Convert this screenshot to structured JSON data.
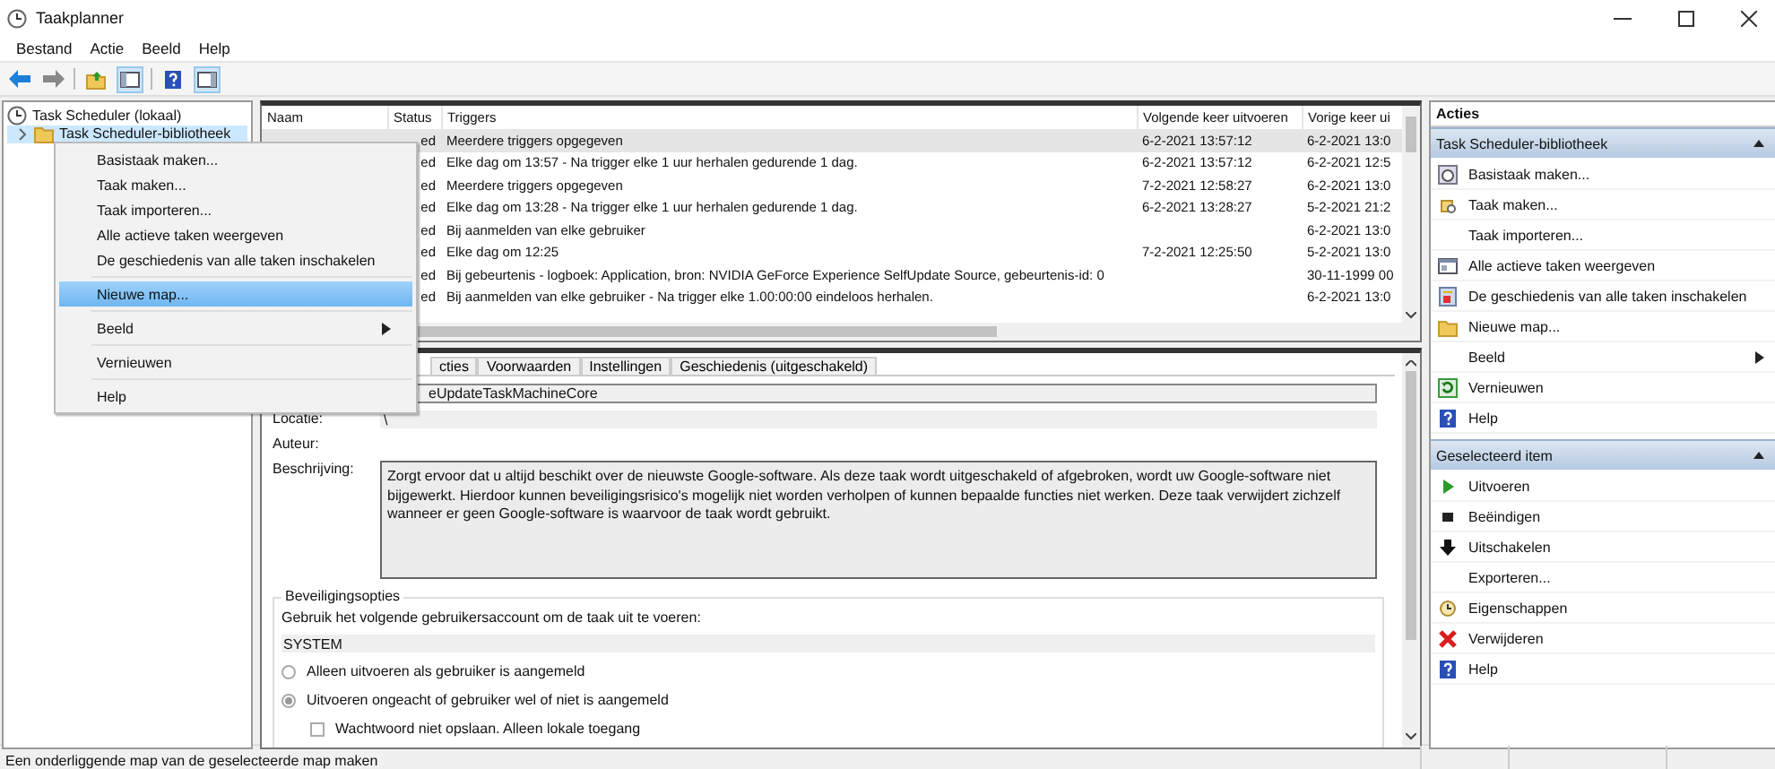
{
  "window": {
    "title": "Taakplanner"
  },
  "menu_bar": [
    "Bestand",
    "Actie",
    "Beeld",
    "Help"
  ],
  "tree": [
    {
      "label": "Task Scheduler (lokaal)",
      "expanded": true,
      "selected": false,
      "children": [
        {
          "label": "Task Scheduler-bibliotheek",
          "expanded": false,
          "selected": true
        }
      ]
    }
  ],
  "context_menu": [
    {
      "kind": "item",
      "label": "Basistaak maken...",
      "selected": false
    },
    {
      "kind": "item",
      "label": "Taak maken...",
      "selected": false
    },
    {
      "kind": "item",
      "label": "Taak importeren...",
      "selected": false
    },
    {
      "kind": "item",
      "label": "Alle actieve taken weergeven",
      "selected": false
    },
    {
      "kind": "item",
      "label": "De geschiedenis van alle taken inschakelen",
      "selected": false
    },
    {
      "kind": "separator"
    },
    {
      "kind": "item",
      "label": "Nieuwe map...",
      "selected": true
    },
    {
      "kind": "separator"
    },
    {
      "kind": "item",
      "label": "Beeld",
      "selected": false,
      "submenu": true
    },
    {
      "kind": "separator"
    },
    {
      "kind": "item",
      "label": "Vernieuwen",
      "selected": false
    },
    {
      "kind": "separator"
    },
    {
      "kind": "item",
      "label": "Help",
      "selected": false
    }
  ],
  "tasks_table": {
    "columns": [
      "Naam",
      "Status",
      "Triggers",
      "Volgende keer uitvoeren",
      "Vorige keer ui"
    ],
    "rows": [
      {
        "status": "ed",
        "triggers": "Meerdere triggers opgegeven",
        "next": "6-2-2021 13:57:12",
        "last": "6-2-2021 13:0",
        "selected": true
      },
      {
        "status": "ed",
        "triggers": "Elke dag om 13:57 - Na trigger elke 1 uur herhalen gedurende 1 dag.",
        "next": "6-2-2021 13:57:12",
        "last": "6-2-2021 12:5",
        "selected": false
      },
      {
        "status": "ed",
        "triggers": "Meerdere triggers opgegeven",
        "next": "7-2-2021 12:58:27",
        "last": "6-2-2021 13:0",
        "selected": false
      },
      {
        "status": "ed",
        "triggers": "Elke dag om 13:28 - Na trigger elke 1 uur herhalen gedurende 1 dag.",
        "next": "6-2-2021 13:28:27",
        "last": "5-2-2021 21:2",
        "selected": false
      },
      {
        "status": "ed",
        "triggers": "Bij aanmelden van elke gebruiker",
        "last": "6-2-2021 13:0",
        "selected": false
      },
      {
        "status": "ed",
        "triggers": "Elke dag om 12:25",
        "next": "7-2-2021 12:25:50",
        "last": "5-2-2021 13:0",
        "selected": false
      },
      {
        "status": "ed",
        "triggers": "Bij gebeurtenis - logboek: Application, bron: NVIDIA GeForce Experience SelfUpdate Source, gebeurtenis-id: 0",
        "last": "30-11-1999 00",
        "selected": false
      },
      {
        "status": "ed",
        "triggers": "Bij aanmelden van elke gebruiker - Na trigger elke 1.00:00:00 eindeloos herhalen.",
        "last": "6-2-2021 13:0",
        "selected": false
      }
    ]
  },
  "detail": {
    "tabs": [
      {
        "label": "cties",
        "selected": false
      },
      {
        "label": "Voorwaarden",
        "selected": false
      },
      {
        "label": "Instellingen",
        "selected": false
      },
      {
        "label": "Geschiedenis (uitgeschakeld)",
        "selected": false
      }
    ],
    "name_value": "eUpdateTaskMachineCore",
    "fields": [
      {
        "kind": "line",
        "label": "Locatie:",
        "value": "\\"
      },
      {
        "kind": "line",
        "label": "Auteur:"
      },
      {
        "kind": "multiline",
        "label": "Beschrijving:",
        "value": "Zorgt ervoor dat u altijd beschikt over de nieuwste Google-software. Als deze taak wordt uitgeschakeld of afgebroken, wordt uw Google-software niet bijgewerkt. Hierdoor kunnen beveiligingsrisico's mogelijk niet worden verholpen of kunnen bepaalde functies niet werken. Deze taak verwijdert zichzelf wanneer er geen Google-software is waarvoor de taak wordt gebruikt."
      }
    ],
    "security": {
      "title": "Beveiligingsopties",
      "prompt": "Gebruik het volgende gebruikersaccount om de taak uit te voeren:",
      "account": "SYSTEM",
      "options": [
        {
          "kind": "radio",
          "label": "Alleen uitvoeren als gebruiker is aangemeld",
          "selected": false
        },
        {
          "kind": "radio",
          "label": "Uitvoeren ongeacht of gebruiker wel of niet is aangemeld",
          "selected": true
        },
        {
          "kind": "checkbox",
          "label": "Wachtwoord niet opslaan. Alleen lokale toegang",
          "checked": false
        }
      ]
    }
  },
  "actions": {
    "title": "Acties",
    "sections": [
      {
        "title": "Task Scheduler-bibliotheek",
        "expanded": true,
        "items": [
          {
            "label": "Basistaak maken..."
          },
          {
            "label": "Taak maken..."
          },
          {
            "label": "Taak importeren..."
          },
          {
            "label": "Alle actieve taken weergeven"
          },
          {
            "label": "De geschiedenis van alle taken inschakelen"
          },
          {
            "label": "Nieuwe map..."
          },
          {
            "label": "Beeld",
            "submenu": true
          },
          {
            "label": "Vernieuwen"
          },
          {
            "label": "Help"
          }
        ]
      },
      {
        "title": "Geselecteerd item",
        "expanded": true,
        "items": [
          {
            "label": "Uitvoeren"
          },
          {
            "label": "Beëindigen"
          },
          {
            "label": "Uitschakelen"
          },
          {
            "label": "Exporteren..."
          },
          {
            "label": "Eigenschappen"
          },
          {
            "label": "Verwijderen"
          },
          {
            "label": "Help"
          }
        ]
      }
    ]
  },
  "status_bar": "Een onderliggende map van de geselecteerde map maken"
}
